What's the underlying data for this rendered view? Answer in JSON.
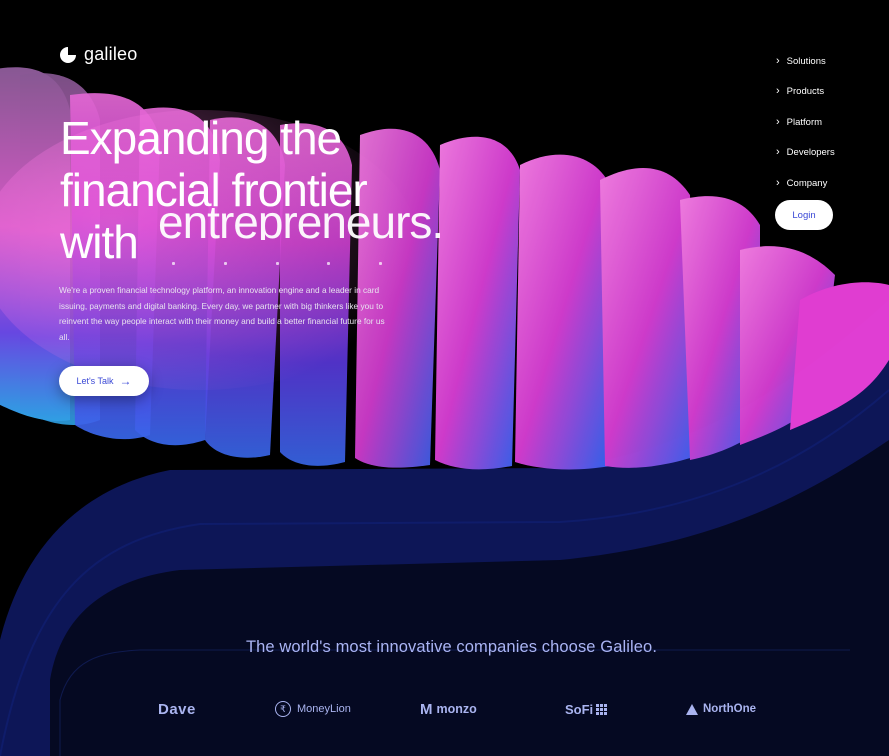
{
  "brand": {
    "name": "galileo"
  },
  "nav": {
    "items": [
      {
        "label": "Solutions"
      },
      {
        "label": "Products"
      },
      {
        "label": "Platform"
      },
      {
        "label": "Developers"
      },
      {
        "label": "Company"
      }
    ],
    "login_label": "Login"
  },
  "hero": {
    "headline_lines": [
      "Expanding the",
      "financial frontier",
      "with"
    ],
    "headline_ghost": "entrepreneurs.",
    "description": "We're a proven financial technology platform, an innovation engine and a leader in card issuing, payments and digital banking. Every day, we partner with big thinkers like you to reinvent the way people interact with their money and build a better financial future for us all.",
    "cta_label": "Let's Talk"
  },
  "clients": {
    "heading": "The world's most innovative companies choose Galileo.",
    "logos": [
      "Dave",
      "MoneyLion",
      "monzo",
      "SoFi",
      "NorthOne"
    ]
  },
  "colors": {
    "background": "#000000",
    "navy_band": "#0d1657",
    "accent_blue": "#3b49d6",
    "magenta": "#e43ed6",
    "logo_tint": "#aab4f0"
  }
}
